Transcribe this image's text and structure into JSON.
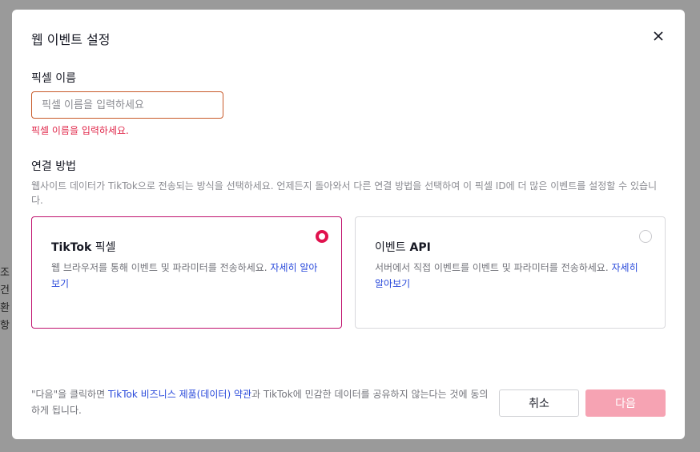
{
  "background": {
    "fragments": [
      "조건",
      "",
      "환",
      "항"
    ]
  },
  "modal": {
    "title": "웹 이벤트 설정",
    "close_icon": "close-icon"
  },
  "pixel_name": {
    "label": "픽셀 이름",
    "placeholder": "픽셀 이름을 입력하세요",
    "value": "",
    "error": "픽셀 이름을 입력하세요."
  },
  "connection": {
    "label": "연결 방법",
    "description": "웹사이트 데이터가 TikTok으로 전송되는 방식을 선택하세요. 언제든지 돌아와서 다른 연결 방법을 선택하여 이 픽셀 ID에 더 많은 이벤트를 설정할 수 있습니다.",
    "options": [
      {
        "title_en": "TikTok",
        "title_ko": " 픽셀",
        "description": "웹 브라우저를 통해 이벤트 및 파라미터를 전송하세요.",
        "link": "자세히 알아보기",
        "selected": true
      },
      {
        "title_ko": "이벤트",
        "title_en": " API",
        "description": "서버에서 직접 이벤트를 이벤트 및 파라미터를 전송하세요.",
        "link": "자세히 알아보기",
        "selected": false
      }
    ]
  },
  "footer": {
    "text_before": "\"다음\"을 클릭하면 ",
    "terms_link": "TikTok 비즈니스 제품(데이터) 약관",
    "text_after": "과 TikTok에 민감한 데이터를 공유하지 않는다는 것에 동의하게 됩니다.",
    "cancel_label": "취소",
    "next_label": "다음"
  },
  "colors": {
    "accent": "#e0124e",
    "selected_border": "#c0126e",
    "error": "#e0284b",
    "link": "#2b4bdb",
    "next_disabled": "#f6a3b3"
  }
}
